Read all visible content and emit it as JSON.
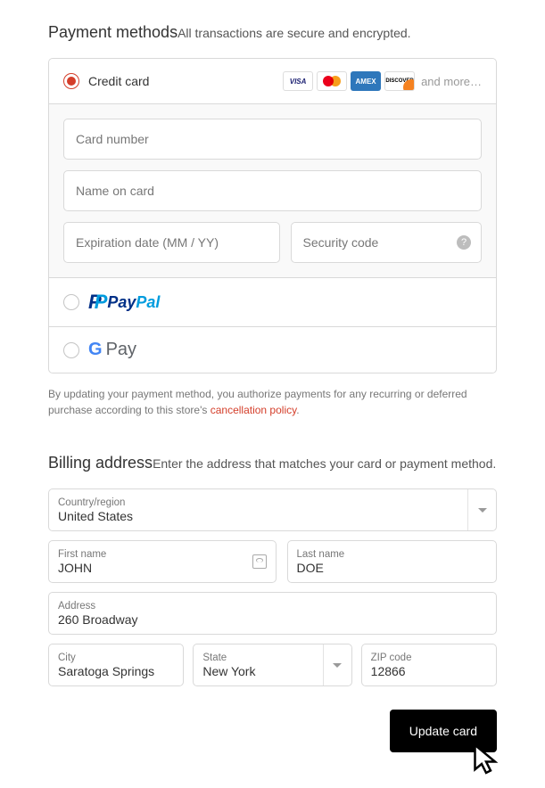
{
  "payment": {
    "title": "Payment methods",
    "subtitle": "All transactions are secure and encrypted.",
    "options": {
      "credit_card_label": "Credit card",
      "paypal_label": "PayPal",
      "gpay_label": "Pay"
    },
    "card_brands_more": "and more…",
    "fields": {
      "card_number_ph": "Card number",
      "name_on_card_ph": "Name on card",
      "expiration_ph": "Expiration date (MM / YY)",
      "security_code_ph": "Security code"
    },
    "disclaimer_prefix": "By updating your payment method, you authorize payments for any recurring or deferred purchase according to this store's ",
    "disclaimer_link": "cancellation policy",
    "disclaimer_suffix": "."
  },
  "billing": {
    "title": "Billing address",
    "subtitle": "Enter the address that matches your card or payment method.",
    "country_label": "Country/region",
    "country_value": "United States",
    "first_name_label": "First name",
    "first_name_value": "JOHN",
    "last_name_label": "Last name",
    "last_name_value": "DOE",
    "address_label": "Address",
    "address_value": "260 Broadway",
    "city_label": "City",
    "city_value": "Saratoga Springs",
    "state_label": "State",
    "state_value": "New York",
    "zip_label": "ZIP code",
    "zip_value": "12866"
  },
  "actions": {
    "update_card": "Update card"
  }
}
